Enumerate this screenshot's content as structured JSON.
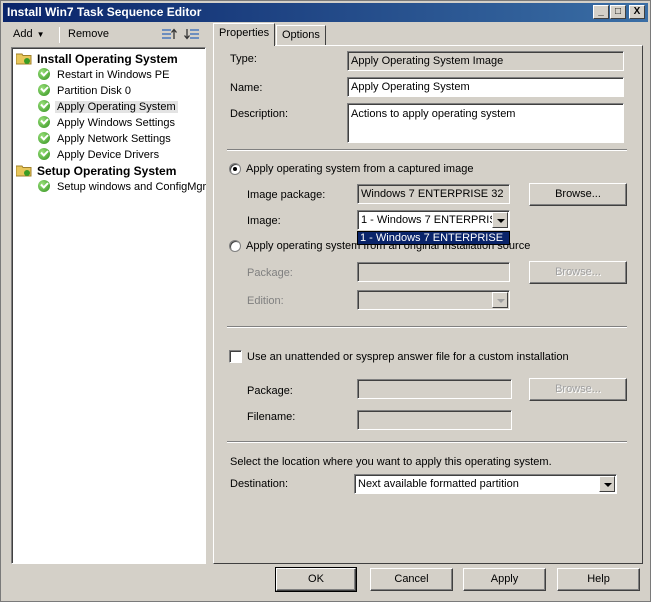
{
  "window": {
    "title": "Install Win7 Task Sequence Editor",
    "controls": [
      "_",
      "□",
      "X"
    ]
  },
  "toolbar": {
    "add_label": "Add",
    "remove_label": "Remove"
  },
  "tree": {
    "groups": [
      {
        "label": "Install Operating System",
        "items": [
          {
            "label": "Restart in Windows PE"
          },
          {
            "label": "Partition Disk 0"
          },
          {
            "label": "Apply Operating System",
            "selected": true
          },
          {
            "label": "Apply Windows Settings"
          },
          {
            "label": "Apply Network Settings"
          },
          {
            "label": "Apply Device Drivers"
          }
        ]
      },
      {
        "label": "Setup Operating System",
        "items": [
          {
            "label": "Setup windows and ConfigMgr"
          }
        ]
      }
    ]
  },
  "tabs": [
    {
      "label": "Properties",
      "active": true
    },
    {
      "label": "Options",
      "active": false
    }
  ],
  "properties": {
    "type_label": "Type:",
    "type_value": "Apply Operating System Image",
    "name_label": "Name:",
    "name_value": "Apply Operating System",
    "description_label": "Description:",
    "description_value": "Actions to apply operating system",
    "captured_radio_label": "Apply operating system from a captured image",
    "image_package_label": "Image package:",
    "image_package_value": "Windows 7 ENTERPRISE 32",
    "browse_label": "Browse...",
    "image_label": "Image:",
    "image_value": "1 - Windows 7 ENTERPRISE",
    "image_dropdown_option": "1 - Windows 7 ENTERPRISE",
    "original_radio_label": "Apply operating system from an original installation source",
    "package_label": "Package:",
    "edition_label": "Edition:",
    "unattended_label": "Use an unattended or sysprep answer file for a custom installation",
    "filename_label": "Filename:",
    "location_text": "Select the location where you want to apply this operating system.",
    "destination_label": "Destination:",
    "destination_value": "Next available formatted partition"
  },
  "footer": {
    "ok_label": "OK",
    "cancel_label": "Cancel",
    "apply_label": "Apply",
    "help_label": "Help"
  }
}
